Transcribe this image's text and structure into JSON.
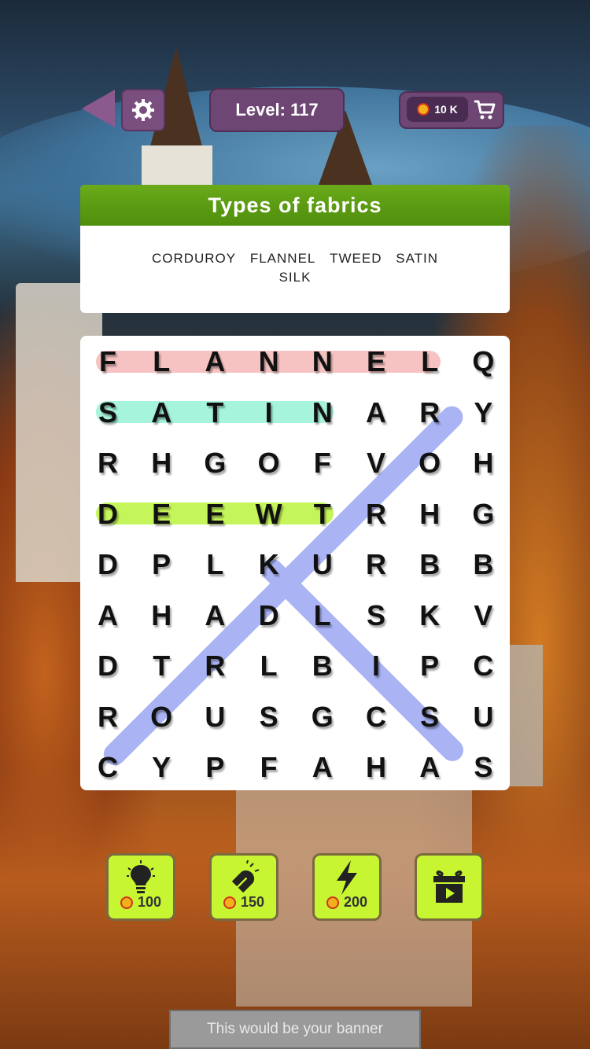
{
  "header": {
    "level_text": "Level: 117",
    "coins_text": "10 K"
  },
  "category": {
    "title": "Types of fabrics",
    "words": [
      "CORDUROY",
      "FLANNEL",
      "TWEED",
      "SATIN",
      "SILK"
    ]
  },
  "grid": {
    "rows": [
      [
        "F",
        "L",
        "A",
        "N",
        "N",
        "E",
        "L",
        "Q"
      ],
      [
        "S",
        "A",
        "T",
        "I",
        "N",
        "A",
        "R",
        "Y"
      ],
      [
        "R",
        "H",
        "G",
        "O",
        "F",
        "V",
        "O",
        "H"
      ],
      [
        "D",
        "E",
        "E",
        "W",
        "T",
        "R",
        "H",
        "G"
      ],
      [
        "D",
        "P",
        "L",
        "K",
        "U",
        "R",
        "B",
        "B"
      ],
      [
        "A",
        "H",
        "A",
        "D",
        "L",
        "S",
        "K",
        "V"
      ],
      [
        "D",
        "T",
        "R",
        "L",
        "B",
        "I",
        "P",
        "C"
      ],
      [
        "R",
        "O",
        "U",
        "S",
        "G",
        "C",
        "S",
        "U"
      ],
      [
        "C",
        "Y",
        "P",
        "F",
        "A",
        "H",
        "A",
        "S"
      ]
    ],
    "found_words": [
      "FLANNEL",
      "SATIN",
      "TWEED",
      "CORDUROY",
      "SILK"
    ],
    "highlight_colors": {
      "FLANNEL": "#f7c2c2",
      "SATIN": "#a6f4dc",
      "TWEED": "#c4f55a",
      "CORDUROY": "#aab4f4",
      "SILK": "#aab4f4"
    }
  },
  "boosters": [
    {
      "name": "hint",
      "icon": "lightbulb-icon",
      "cost": "100"
    },
    {
      "name": "magnet",
      "icon": "magnet-icon",
      "cost": "150"
    },
    {
      "name": "lightning",
      "icon": "lightning-icon",
      "cost": "200"
    },
    {
      "name": "video-reward",
      "icon": "gift-video-icon",
      "cost": ""
    }
  ],
  "banner": {
    "text": "This would be your banner"
  },
  "colors": {
    "accent_green": "#5a9a10",
    "booster_green": "#c8f531",
    "purple_button": "#6d4673"
  }
}
